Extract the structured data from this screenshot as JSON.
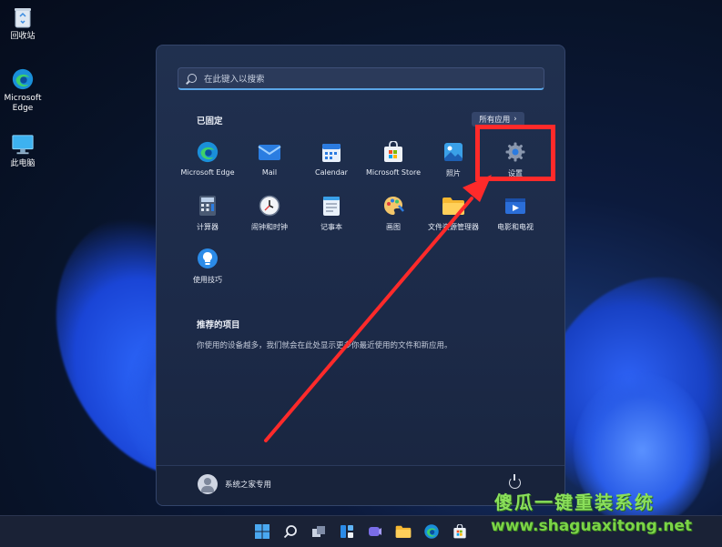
{
  "desktop": {
    "icons": [
      {
        "label": "回收站",
        "icon": "recycle-bin-icon"
      },
      {
        "label": "Microsoft Edge",
        "icon": "edge-icon"
      },
      {
        "label": "此电脑",
        "icon": "this-pc-icon"
      }
    ]
  },
  "start_menu": {
    "search_placeholder": "在此键入以搜索",
    "pinned_title": "已固定",
    "all_apps_label": "所有应用",
    "all_apps_chevron": "›",
    "pinned_apps": [
      {
        "label": "Microsoft Edge",
        "icon": "edge-icon"
      },
      {
        "label": "Mail",
        "icon": "mail-icon"
      },
      {
        "label": "Calendar",
        "icon": "calendar-icon"
      },
      {
        "label": "Microsoft Store",
        "icon": "store-icon"
      },
      {
        "label": "照片",
        "icon": "photos-icon"
      },
      {
        "label": "设置",
        "icon": "gear-icon"
      },
      {
        "label": "计算器",
        "icon": "calculator-icon"
      },
      {
        "label": "闹钟和时钟",
        "icon": "clock-icon"
      },
      {
        "label": "记事本",
        "icon": "notepad-icon"
      },
      {
        "label": "画图",
        "icon": "paint-icon"
      },
      {
        "label": "文件资源管理器",
        "icon": "folder-icon"
      },
      {
        "label": "电影和电视",
        "icon": "movies-icon"
      },
      {
        "label": "使用技巧",
        "icon": "tips-icon"
      }
    ],
    "recommended_title": "推荐的项目",
    "recommended_desc": "你使用的设备越多，我们就会在此处显示更多你最近使用的文件和新应用。",
    "user_name": "系统之家专用"
  },
  "taskbar": {
    "items": [
      "start-icon",
      "search-icon",
      "task-view-icon",
      "widgets-icon",
      "chat-icon",
      "file-explorer-icon",
      "edge-icon",
      "store-icon"
    ]
  },
  "watermark": {
    "line1": "傻瓜一键重装系统",
    "line2": "www.shaguaxitong.net"
  },
  "colors": {
    "annotation": "#ff2a2a",
    "accent": "#5aa6e8"
  }
}
